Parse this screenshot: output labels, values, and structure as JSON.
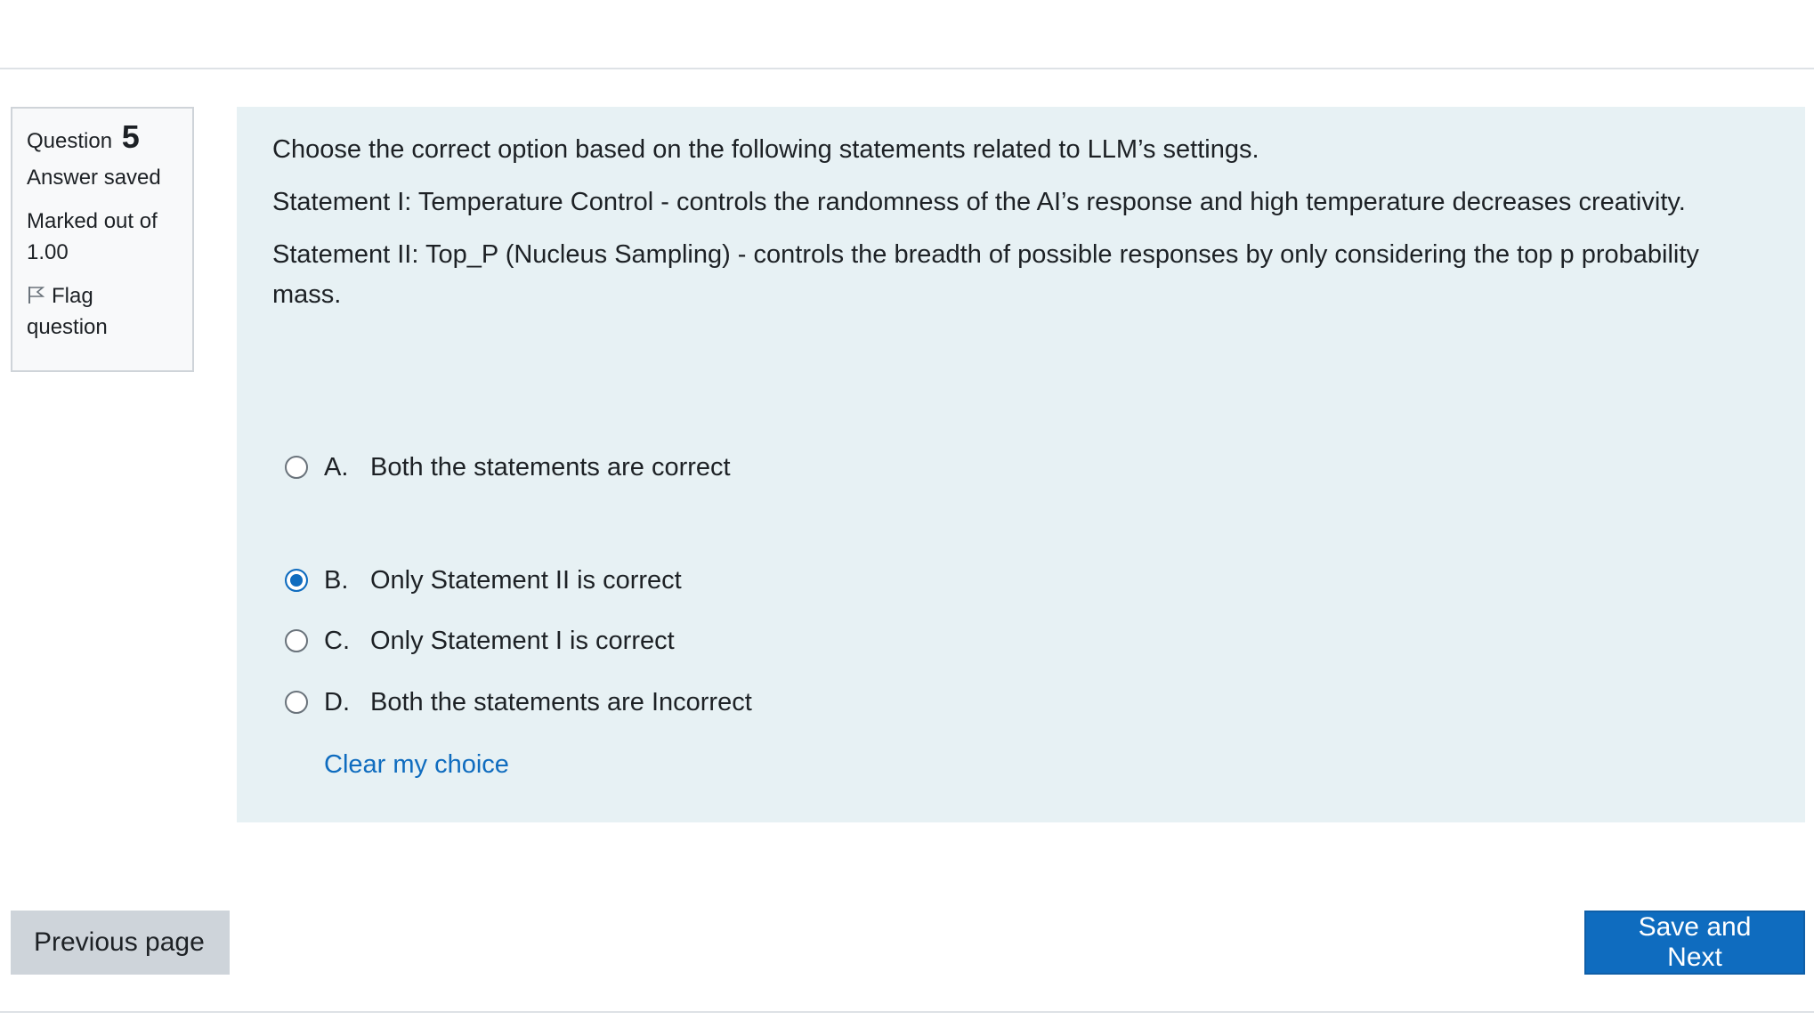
{
  "question_info": {
    "question_label": "Question",
    "question_number": "5",
    "state": "Answer saved",
    "grade": "Marked out of 1.00",
    "flag_label": "Flag question"
  },
  "question": {
    "prompt": "Choose the correct option based on the following statements related to LLM’s settings.",
    "statement_1": "Statement I: Temperature Control - controls the randomness of the AI’s response and high temperature decreases creativity.",
    "statement_2": "Statement II: Top_P (Nucleus Sampling) - controls the breadth of possible responses by only considering the top p probability mass."
  },
  "answers": [
    {
      "letter": "A.",
      "text": "Both the statements are correct",
      "selected": false
    },
    {
      "letter": "B.",
      "text": "Only Statement II is correct",
      "selected": true
    },
    {
      "letter": "C.",
      "text": "Only Statement I is correct",
      "selected": false
    },
    {
      "letter": "D.",
      "text": "Both the statements are Incorrect",
      "selected": false
    }
  ],
  "clear_choice_label": "Clear my choice",
  "navigation": {
    "previous_label": "Previous page",
    "next_label": "Save and Next"
  },
  "colors": {
    "accent": "#0f6cbf",
    "content_bg": "#e7f1f4",
    "secondary_button": "#ced4da"
  }
}
